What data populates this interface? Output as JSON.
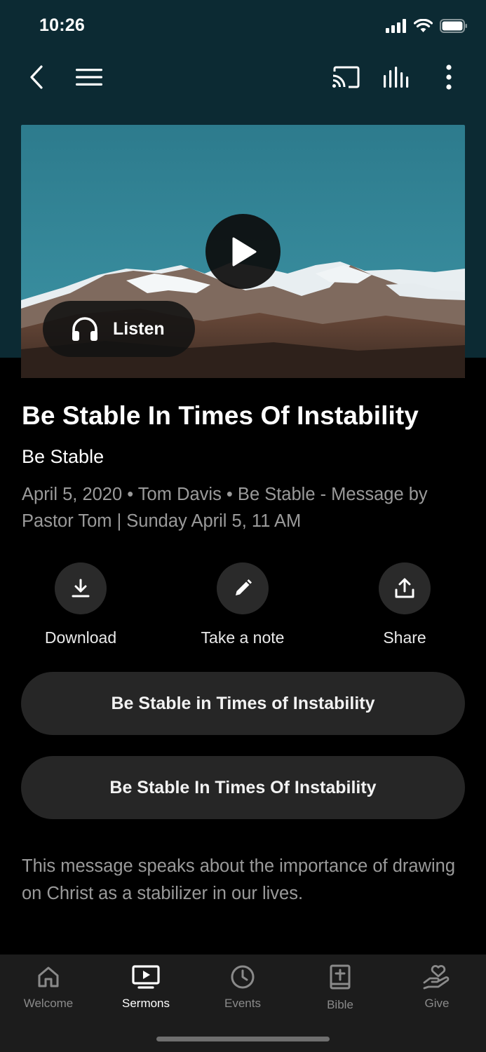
{
  "status_bar": {
    "time": "10:26",
    "icons": [
      "cellular-signal-icon",
      "wifi-icon",
      "battery-icon"
    ]
  },
  "nav": {
    "icons": [
      "back-chevron-icon",
      "hamburger-menu-icon",
      "cast-icon",
      "audio-bars-icon",
      "more-vertical-icon"
    ]
  },
  "hero": {
    "listen_label": "Listen",
    "play_icon": "play-icon",
    "headphones_icon": "headphones-icon"
  },
  "sermon": {
    "title": "Be Stable In Times Of Instability",
    "series": "Be Stable",
    "meta": "April 5, 2020 • Tom Davis • Be Stable - Message by Pastor Tom | Sunday April 5, 11 AM",
    "description": "This message speaks about the importance of drawing on Christ as a stabilizer in our lives."
  },
  "actions": [
    {
      "label": "Download",
      "icon": "download-icon"
    },
    {
      "label": "Take a note",
      "icon": "pencil-icon"
    },
    {
      "label": "Share",
      "icon": "share-icon"
    }
  ],
  "buttons": [
    {
      "label": "Be Stable in Times of Instability"
    },
    {
      "label": "Be Stable In Times Of Instability"
    }
  ],
  "tabs": [
    {
      "label": "Welcome",
      "icon": "home-icon",
      "active": false
    },
    {
      "label": "Sermons",
      "icon": "tv-play-icon",
      "active": true
    },
    {
      "label": "Events",
      "icon": "clock-icon",
      "active": false
    },
    {
      "label": "Bible",
      "icon": "bible-icon",
      "active": false
    },
    {
      "label": "Give",
      "icon": "give-heart-hand-icon",
      "active": false
    }
  ],
  "colors": {
    "header_bg": "#0c2a33",
    "page_bg": "#000000",
    "button_bg": "#262626",
    "tabbar_bg": "#1c1c1c",
    "muted_text": "#9a9a9a"
  }
}
